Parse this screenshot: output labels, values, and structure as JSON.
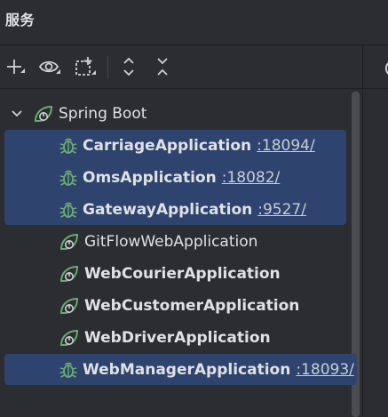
{
  "panel": {
    "title": "服务"
  },
  "toolbar": {
    "buttons": [
      {
        "name": "add-icon"
      },
      {
        "name": "eye-icon"
      },
      {
        "name": "new-group-icon"
      },
      {
        "name": "expand-all-icon"
      },
      {
        "name": "collapse-all-icon"
      }
    ]
  },
  "tree": {
    "group": {
      "label": "Spring Boot",
      "expanded": true
    },
    "items": [
      {
        "label": "CarriageApplication",
        "port": ":18094/",
        "running": true,
        "bold": true
      },
      {
        "label": "OmsApplication",
        "port": ":18082/",
        "running": true,
        "bold": true
      },
      {
        "label": "GatewayApplication",
        "port": ":9527/",
        "running": true,
        "bold": true
      },
      {
        "label": "GitFlowWebApplication",
        "port": "",
        "running": false,
        "bold": false
      },
      {
        "label": "WebCourierApplication",
        "port": "",
        "running": false,
        "bold": true
      },
      {
        "label": "WebCustomerApplication",
        "port": "",
        "running": false,
        "bold": true
      },
      {
        "label": "WebDriverApplication",
        "port": "",
        "running": false,
        "bold": true
      },
      {
        "label": "WebManagerApplication",
        "port": ":18093/",
        "running": true,
        "bold": true
      }
    ]
  },
  "colors": {
    "background": "#2b2d30",
    "selection": "#2e436e",
    "spring_green": "#6aab73",
    "text": "#dfe1e5"
  }
}
